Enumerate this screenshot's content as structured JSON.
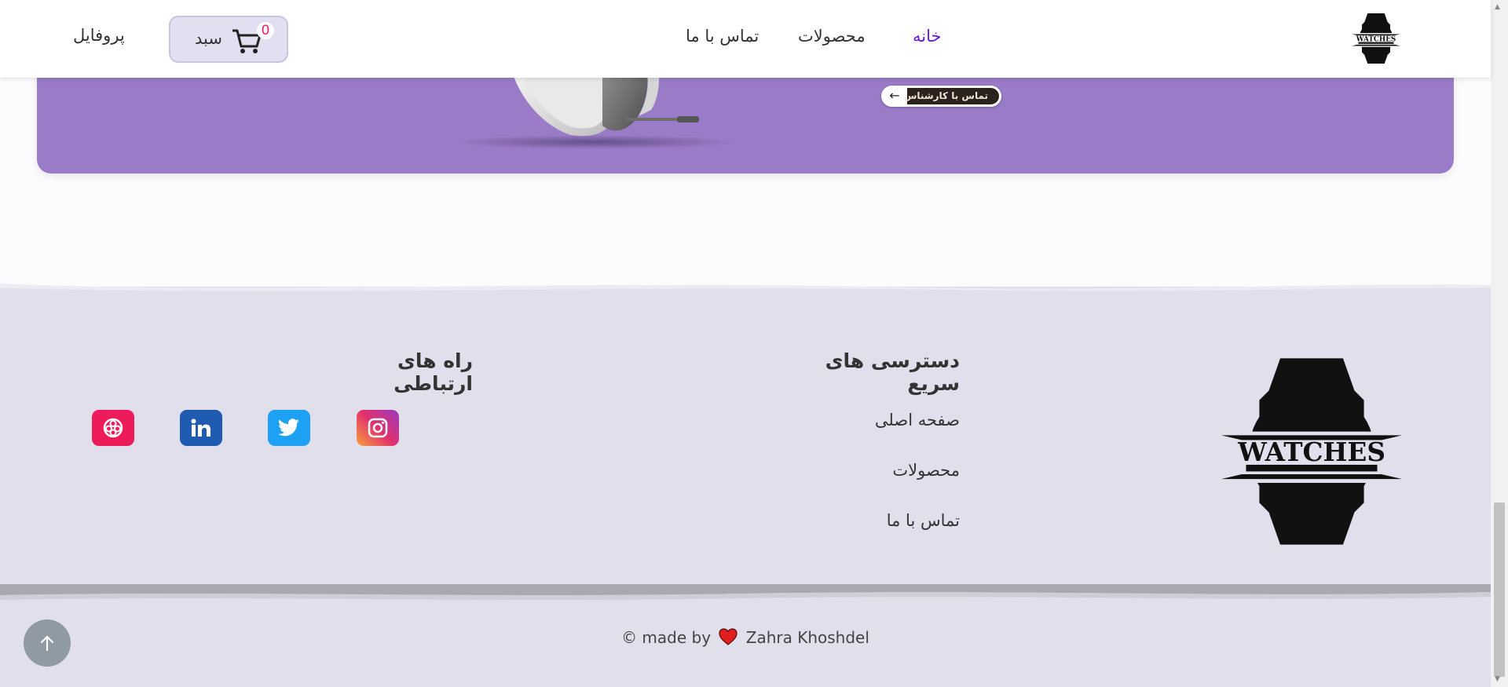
{
  "header": {
    "profile_label": "پروفایل",
    "cart_label": "سبد",
    "cart_count": "0",
    "nav": {
      "home": "خانه",
      "products": "محصولات",
      "contact": "تماس با ما"
    },
    "active_color": "#6a1be0",
    "logo_icon": "watches-logo-icon"
  },
  "banner": {
    "background": "#997bc7",
    "cta_label": "تماس با کارشناس",
    "cta_icon": "arrow-left-icon"
  },
  "footer": {
    "quick_access": {
      "title": "دسترسی های سریع",
      "links": [
        "صفحه اصلی",
        "محصولات",
        "تماس با ما"
      ]
    },
    "contact_ways": {
      "title": "راه های ارتباطی",
      "socials": [
        "instagram-icon",
        "twitter-icon",
        "linkedin-icon",
        "app-icon"
      ]
    },
    "credit": {
      "prefix": "© made by",
      "author": "Zahra Khoshdel",
      "heart_color": "#e01e1e"
    }
  },
  "scroll_top_icon": "arrow-up-icon"
}
